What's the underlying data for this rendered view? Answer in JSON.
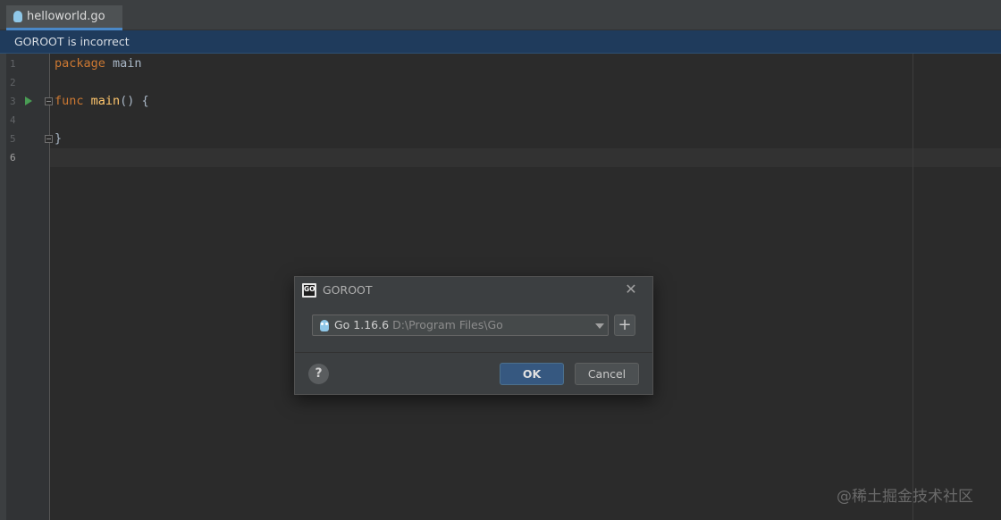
{
  "tab": {
    "filename": "helloworld.go"
  },
  "banner": {
    "message": "GOROOT is incorrect"
  },
  "gutter": {
    "line_numbers": [
      "1",
      "2",
      "3",
      "4",
      "5",
      "6"
    ]
  },
  "code": {
    "line1": {
      "kw": "package",
      "name": "main"
    },
    "line3": {
      "kw": "func",
      "fn": "main",
      "rest": "() {"
    },
    "line5": {
      "text": "}"
    }
  },
  "dialog": {
    "title": "GOROOT",
    "logo_text": "GO",
    "close_glyph": "✕",
    "sdk": {
      "version": "Go 1.16.6",
      "path": "D:\\Program Files\\Go"
    },
    "add_glyph": "+",
    "help_glyph": "?",
    "ok_label": "OK",
    "cancel_label": "Cancel"
  },
  "watermark": "@稀土掘金技术社区"
}
